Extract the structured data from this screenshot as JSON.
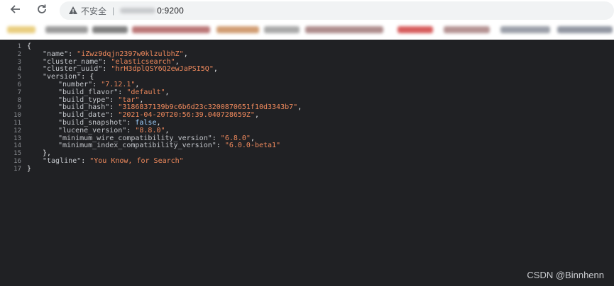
{
  "browser": {
    "security_label": "不安全",
    "url_visible": "0:9200"
  },
  "json_viewer": {
    "lines": [
      {
        "n": "1",
        "indent": 0,
        "parts": [
          {
            "t": "punct",
            "v": "{"
          }
        ]
      },
      {
        "n": "2",
        "indent": 1,
        "parts": [
          {
            "t": "key",
            "v": "\"name\""
          },
          {
            "t": "punct",
            "v": ": "
          },
          {
            "t": "str",
            "v": "\"iZwz9dqjn2397w0klzulbhZ\""
          },
          {
            "t": "punct",
            "v": ","
          }
        ]
      },
      {
        "n": "3",
        "indent": 1,
        "parts": [
          {
            "t": "key",
            "v": "\"cluster_name\""
          },
          {
            "t": "punct",
            "v": ": "
          },
          {
            "t": "str",
            "v": "\"elasticsearch\""
          },
          {
            "t": "punct",
            "v": ","
          }
        ]
      },
      {
        "n": "4",
        "indent": 1,
        "parts": [
          {
            "t": "key",
            "v": "\"cluster_uuid\""
          },
          {
            "t": "punct",
            "v": ": "
          },
          {
            "t": "str",
            "v": "\"hrH3dplQSY6Q2ewJaPSI5Q\""
          },
          {
            "t": "punct",
            "v": ","
          }
        ]
      },
      {
        "n": "5",
        "indent": 1,
        "parts": [
          {
            "t": "key",
            "v": "\"version\""
          },
          {
            "t": "punct",
            "v": ": {"
          }
        ]
      },
      {
        "n": "6",
        "indent": 2,
        "parts": [
          {
            "t": "key",
            "v": "\"number\""
          },
          {
            "t": "punct",
            "v": ": "
          },
          {
            "t": "str",
            "v": "\"7.12.1\""
          },
          {
            "t": "punct",
            "v": ","
          }
        ]
      },
      {
        "n": "7",
        "indent": 2,
        "parts": [
          {
            "t": "key",
            "v": "\"build_flavor\""
          },
          {
            "t": "punct",
            "v": ": "
          },
          {
            "t": "str",
            "v": "\"default\""
          },
          {
            "t": "punct",
            "v": ","
          }
        ]
      },
      {
        "n": "8",
        "indent": 2,
        "parts": [
          {
            "t": "key",
            "v": "\"build_type\""
          },
          {
            "t": "punct",
            "v": ": "
          },
          {
            "t": "str",
            "v": "\"tar\""
          },
          {
            "t": "punct",
            "v": ","
          }
        ]
      },
      {
        "n": "9",
        "indent": 2,
        "parts": [
          {
            "t": "key",
            "v": "\"build_hash\""
          },
          {
            "t": "punct",
            "v": ": "
          },
          {
            "t": "str",
            "v": "\"3186837139b9c6b6d23c3200870651f10d3343b7\""
          },
          {
            "t": "punct",
            "v": ","
          }
        ]
      },
      {
        "n": "10",
        "indent": 2,
        "parts": [
          {
            "t": "key",
            "v": "\"build_date\""
          },
          {
            "t": "punct",
            "v": ": "
          },
          {
            "t": "str",
            "v": "\"2021-04-20T20:56:39.040728659Z\""
          },
          {
            "t": "punct",
            "v": ","
          }
        ]
      },
      {
        "n": "11",
        "indent": 2,
        "parts": [
          {
            "t": "key",
            "v": "\"build_snapshot\""
          },
          {
            "t": "punct",
            "v": ": "
          },
          {
            "t": "bool",
            "v": "false"
          },
          {
            "t": "punct",
            "v": ","
          }
        ]
      },
      {
        "n": "12",
        "indent": 2,
        "parts": [
          {
            "t": "key",
            "v": "\"lucene_version\""
          },
          {
            "t": "punct",
            "v": ": "
          },
          {
            "t": "str",
            "v": "\"8.8.0\""
          },
          {
            "t": "punct",
            "v": ","
          }
        ]
      },
      {
        "n": "13",
        "indent": 2,
        "parts": [
          {
            "t": "key",
            "v": "\"minimum_wire_compatibility_version\""
          },
          {
            "t": "punct",
            "v": ": "
          },
          {
            "t": "str",
            "v": "\"6.8.0\""
          },
          {
            "t": "punct",
            "v": ","
          }
        ]
      },
      {
        "n": "14",
        "indent": 2,
        "parts": [
          {
            "t": "key",
            "v": "\"minimum_index_compatibility_version\""
          },
          {
            "t": "punct",
            "v": ": "
          },
          {
            "t": "str",
            "v": "\"6.0.0-beta1\""
          }
        ]
      },
      {
        "n": "15",
        "indent": 1,
        "parts": [
          {
            "t": "punct",
            "v": "},"
          }
        ]
      },
      {
        "n": "16",
        "indent": 1,
        "parts": [
          {
            "t": "key",
            "v": "\"tagline\""
          },
          {
            "t": "punct",
            "v": ": "
          },
          {
            "t": "str",
            "v": "\"You Know, for Search\""
          }
        ]
      },
      {
        "n": "17",
        "indent": 0,
        "parts": [
          {
            "t": "punct",
            "v": "}"
          }
        ]
      }
    ]
  },
  "watermark": "CSDN @Binnhenn"
}
